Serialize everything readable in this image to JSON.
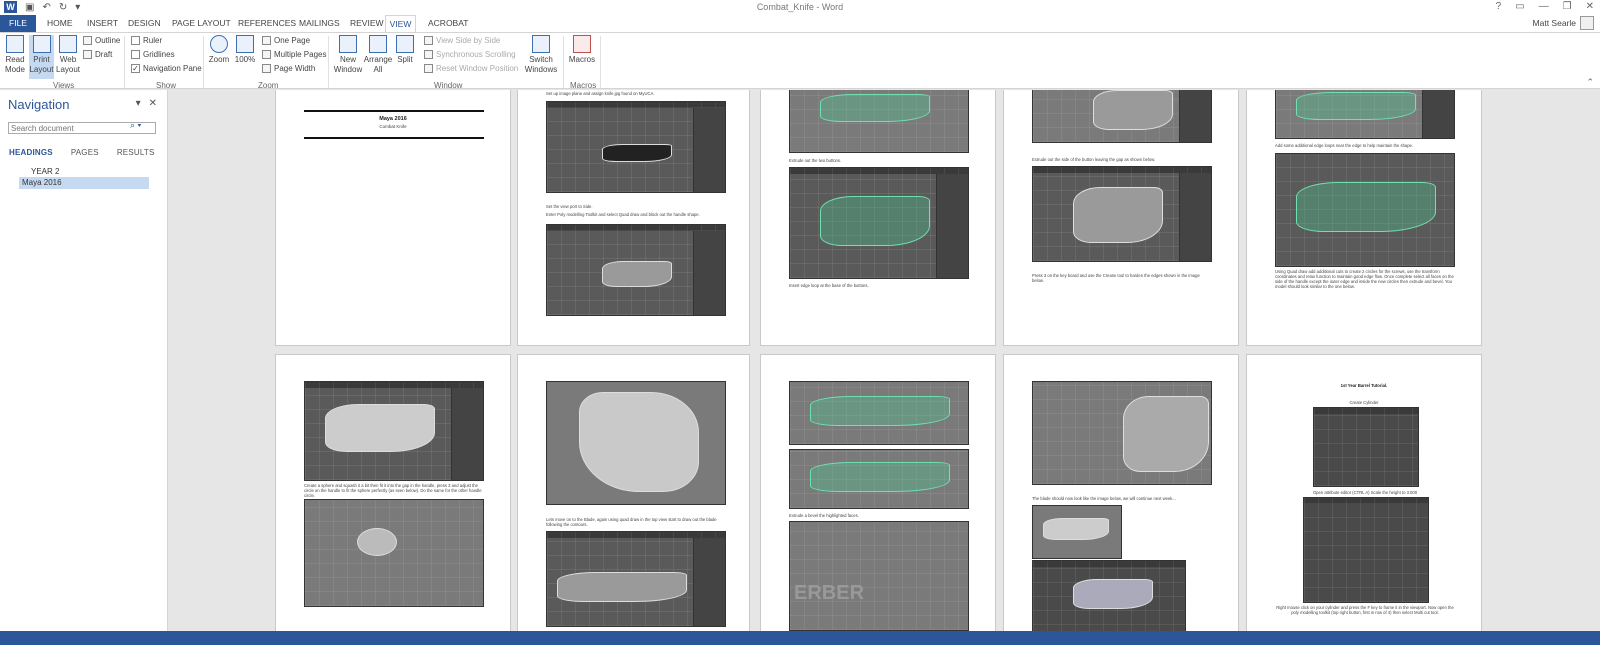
{
  "window": {
    "title": "Combat_Knife - Word",
    "qat": {
      "undo": "↶",
      "redo": "↻"
    }
  },
  "tabs": [
    "FILE",
    "HOME",
    "INSERT",
    "DESIGN",
    "PAGE LAYOUT",
    "REFERENCES",
    "MAILINGS",
    "REVIEW",
    "VIEW",
    "ACROBAT"
  ],
  "active_tab": "VIEW",
  "user": "Matt Searle",
  "window_controls": [
    "?",
    "▭",
    "—",
    "❐",
    "✕"
  ],
  "ribbon": {
    "views": {
      "label": "Views",
      "read_mode": "Read Mode",
      "print_layout": "Print Layout",
      "web_layout": "Web Layout",
      "outline": "Outline",
      "draft": "Draft"
    },
    "show": {
      "label": "Show",
      "ruler": "Ruler",
      "gridlines": "Gridlines",
      "navigation_pane": "Navigation Pane"
    },
    "zoom": {
      "label": "Zoom",
      "zoom": "Zoom",
      "hundred": "100%",
      "one_page": "One Page",
      "multiple_pages": "Multiple Pages",
      "page_width": "Page Width"
    },
    "window": {
      "label": "Window",
      "new_window": "New Window",
      "arrange_all": "Arrange All",
      "split": "Split",
      "side_by_side": "View Side by Side",
      "sync_scroll": "Synchronous Scrolling",
      "reset_pos": "Reset Window Position",
      "switch_windows": "Switch Windows"
    },
    "macros": {
      "label": "Macros",
      "macros": "Macros"
    }
  },
  "nav": {
    "title": "Navigation",
    "search_placeholder": "Search document",
    "tabs": [
      "HEADINGS",
      "PAGES",
      "RESULTS"
    ],
    "headings": [
      {
        "label": "YEAR 2",
        "selected": false
      },
      {
        "label": "Maya 2016",
        "selected": true
      }
    ]
  },
  "pages": {
    "p1": {
      "title": "Maya 2016",
      "subtitle": "Combat Knife"
    },
    "p2": {
      "c1": "Set up image plane and assign knife.jpg found on MyUCA.",
      "c2": "Set the view port to Side.",
      "c3": "Enter Poly modelling Toolkit and select Quad draw and block out the handle shape."
    },
    "p3": {
      "c1": "Extrude out the two buttons.",
      "c2": "Insert edge loop at the base of the buttons."
    },
    "p4": {
      "c1": "Extrude out the side of the button leaving the gap as shown below.",
      "c2": "Press 3 on the key board and use the Crease tool to harden the edges shown in the image below."
    },
    "p5": {
      "c1": "Add some additional edge loops near the edge to help maintain the shape.",
      "c2": "Using Quad draw add additional cuts to create 2 circles for the screws, use the transform coordinates and relax function to maintain good edge flow. Once complete select all faces on the side of the handle except the outer edge and inside the new circles then extrude and bevel. You model should look similar to the one below."
    },
    "p6": {
      "c1": "Create a sphere and squash it a bit then fit it into the gap in the handle, press 3 and adjust the circle on the handle to fit the sphere perfectly (as seen below). Do the same for the other handle circle."
    },
    "p7": {
      "c1": "Lets move on to the Blade, again using quad draw in the top view start to draw out the blade following the contours."
    },
    "p8": {
      "c1": "Extrude a bevel the highlighted faces.",
      "watermark": "ERBER"
    },
    "p9": {
      "c1": "The blade should now look like the image below, we will continue next week..."
    },
    "p10": {
      "title": "1st Year Barrel Tutorial.",
      "c1": "Create Cylinder",
      "c2": "Open attribute editor (CTRL A) Scale the height to 3.000",
      "c3": "Right mouse click on your cylinder and press the F key to frame it in the viewport. Now open the poly modelling toolkit (top right button, first in row of 4) then select Multi cut tool."
    }
  }
}
